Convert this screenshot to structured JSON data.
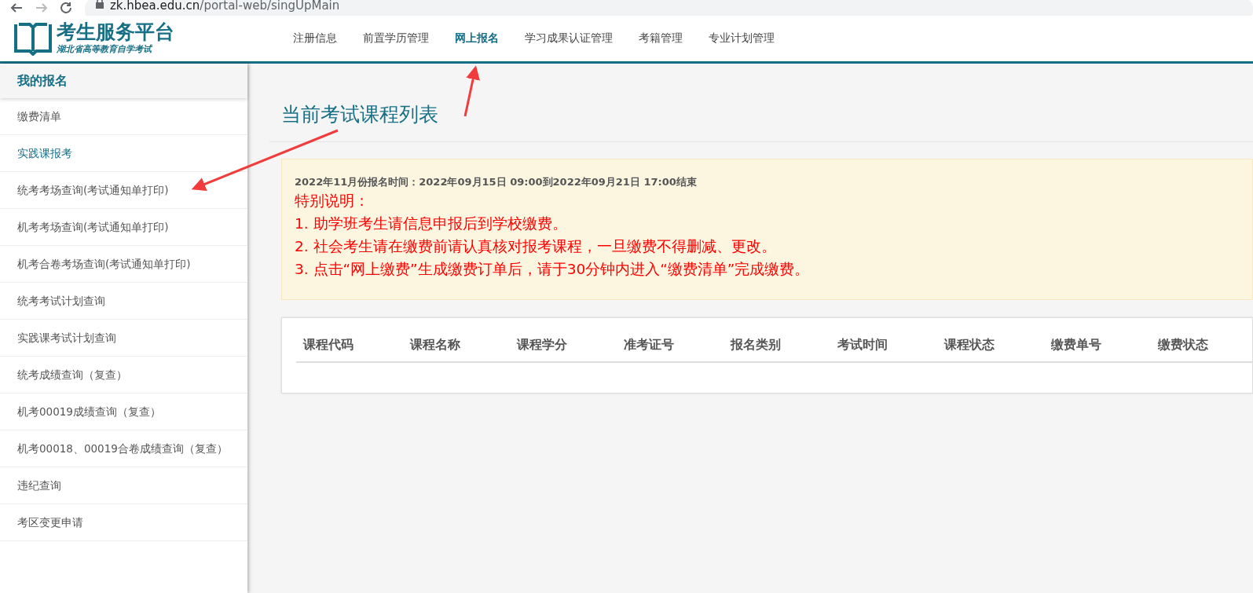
{
  "browser": {
    "nav_buttons": [
      {
        "kind": "back",
        "disabled": false
      },
      {
        "kind": "forward",
        "disabled": true
      },
      {
        "kind": "reload",
        "disabled": false
      }
    ],
    "url_host": "zk.hbea.edu.cn",
    "url_path": "/portal-web/singUpMain"
  },
  "header": {
    "logo_title": "考生服务平台",
    "logo_subtitle": "湖北省高等教育自学考试",
    "nav": [
      {
        "label": "注册信息",
        "selected": false
      },
      {
        "label": "前置学历管理",
        "selected": false
      },
      {
        "label": "网上报名",
        "selected": true
      },
      {
        "label": "学习成果认证管理",
        "selected": false
      },
      {
        "label": "考籍管理",
        "selected": false
      },
      {
        "label": "专业计划管理",
        "selected": false
      }
    ]
  },
  "sidebar": {
    "title": "我的报名",
    "items": [
      {
        "label": "缴费清单",
        "selected": false
      },
      {
        "label": "实践课报考",
        "selected": true
      },
      {
        "label": "统考考场查询(考试通知单打印)",
        "selected": false
      },
      {
        "label": "机考考场查询(考试通知单打印)",
        "selected": false
      },
      {
        "label": "机考合卷考场查询(考试通知单打印)",
        "selected": false
      },
      {
        "label": "统考考试计划查询",
        "selected": false
      },
      {
        "label": "实践课考试计划查询",
        "selected": false
      },
      {
        "label": "统考成绩查询（复查）",
        "selected": false
      },
      {
        "label": "机考00019成绩查询（复查）",
        "selected": false
      },
      {
        "label": "机考00018、00019合卷成绩查询（复查）",
        "selected": false
      },
      {
        "label": "违纪查询",
        "selected": false
      },
      {
        "label": "考区变更申请",
        "selected": false
      }
    ]
  },
  "page_title": "当前考试课程列表",
  "notice": {
    "period": "2022年11月份报名时间：2022年09月15日 09:00到2022年09月21日 17:00结束",
    "heading": "特别说明：",
    "lines": [
      "1. 助学班考生请信息申报后到学校缴费。",
      "2. 社会考生请在缴费前请认真核对报考课程，一旦缴费不得删减、更改。",
      "3. 点击“网上缴费”生成缴费订单后，请于30分钟内进入“缴费清单”完成缴费。"
    ]
  },
  "table": {
    "columns": [
      "课程代码",
      "课程名称",
      "课程学分",
      "准考证号",
      "报名类别",
      "考试时间",
      "课程状态",
      "缴费单号",
      "缴费状态"
    ]
  }
}
